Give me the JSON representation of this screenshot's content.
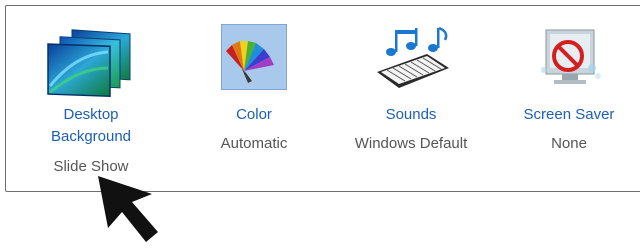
{
  "items": [
    {
      "name_line1": "Desktop",
      "name_line2": "Background",
      "status": "Slide Show",
      "icon": "desktop-background-icon"
    },
    {
      "name": "Color",
      "status": "Automatic",
      "icon": "color-palette-icon"
    },
    {
      "name": "Sounds",
      "status": "Windows Default",
      "icon": "sounds-piano-icon"
    },
    {
      "name": "Screen Saver",
      "status": "None",
      "icon": "screen-saver-icon"
    }
  ],
  "colors": {
    "link": "#1d5fb4",
    "status": "#555555",
    "color_tile": "#a8c8ec"
  },
  "cursor": {
    "icon": "mouse-pointer-icon"
  }
}
